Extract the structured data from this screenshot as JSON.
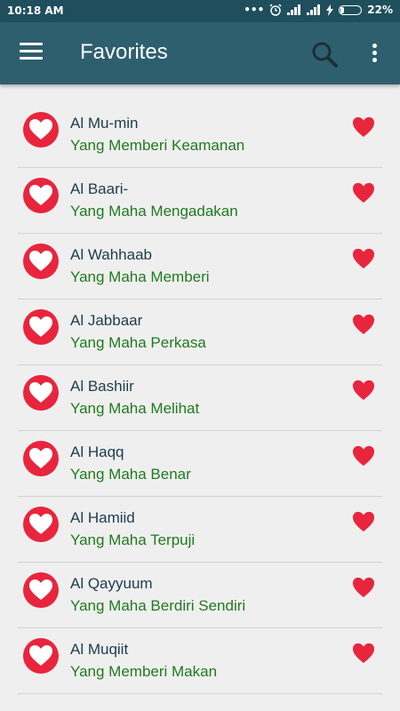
{
  "status": {
    "time": "10:18 AM",
    "battery": "22%",
    "battery_level": 0.22
  },
  "appbar": {
    "title": "Favorites",
    "menu_icon": "menu-icon",
    "search_icon": "search-icon",
    "more_icon": "more-vert-icon"
  },
  "colors": {
    "statusbar": "#1f4f5c",
    "appbar": "#2e5f6e",
    "accent_red": "#e8253d",
    "name": "#1e3c4b",
    "meaning": "#1f7a1f"
  },
  "items": [
    {
      "name": "Al Mu-min",
      "meaning": "Yang Memberi Keamanan"
    },
    {
      "name": "Al Baari-",
      "meaning": "Yang Maha Mengadakan"
    },
    {
      "name": "Al Wahhaab",
      "meaning": "Yang Maha Memberi"
    },
    {
      "name": "Al Jabbaar",
      "meaning": "Yang Maha Perkasa"
    },
    {
      "name": "Al Bashiir",
      "meaning": "Yang Maha Melihat"
    },
    {
      "name": "Al Haqq",
      "meaning": "Yang Maha Benar"
    },
    {
      "name": "Al Hamiid",
      "meaning": "Yang Maha Terpuji"
    },
    {
      "name": "Al Qayyuum",
      "meaning": "Yang Maha Berdiri Sendiri"
    },
    {
      "name": "Al Muqiit",
      "meaning": "Yang Memberi Makan"
    }
  ]
}
